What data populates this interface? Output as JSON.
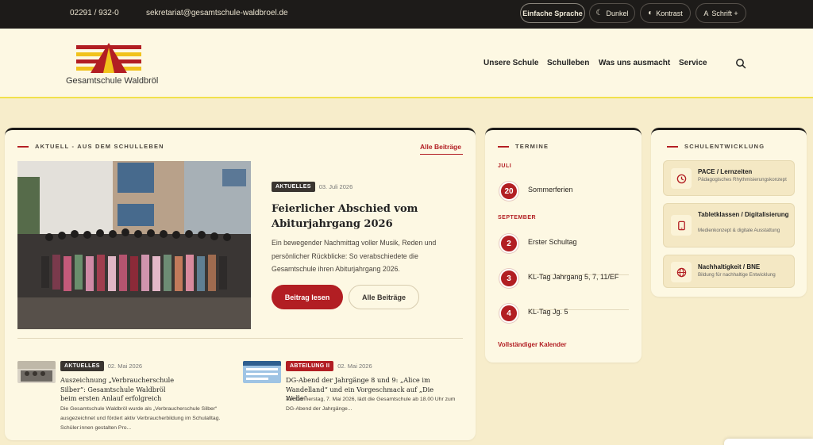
{
  "topbar": {
    "phone": "02291 / 932-0",
    "email": "sekretariat@gesamtschule-waldbroel.de",
    "buttons": {
      "simple_language": "Einfache Sprache",
      "dark": "Dunkel",
      "contrast": "Kontrast",
      "font": "Schrift +",
      "font_prefix": "A"
    }
  },
  "header": {
    "logo_text": "Gesamtschule Waldbröl",
    "nav": [
      "Unsere Schule",
      "Schulleben",
      "Was uns ausmacht",
      "Service"
    ]
  },
  "news": {
    "section_title": "AKTUELL - AUS DEM SCHULLEBEN",
    "all_link": "Alle Beiträge",
    "featured": {
      "badge": "AKTUELLES",
      "date": "03. Juli 2026",
      "title": "Feierlicher Abschied vom Abiturjahrgang 2026",
      "text": "Ein bewegender Nachmittag voller Musik, Reden und persönlicher Rückblicke: So verabschiedete die Gesamtschule ihren Abiturjahrgang 2026.",
      "read_button": "Beitrag lesen",
      "all_button": "Alle Beiträge"
    },
    "items": [
      {
        "badge": "AKTUELLES",
        "date": "02. Mai 2026",
        "title": "Auszeichnung „Verbraucherschule Silber“: Gesamtschule Waldbröl beim ersten Anlauf erfolgreich",
        "text": "Die Gesamtschule Waldbröl wurde als „Verbraucherschule Silber“ ausgezeichnet und fördert aktiv Verbraucherbildung im Schulalltag. Schüler:innen gestalten Pro..."
      },
      {
        "badge": "ABTEILUNG II",
        "date": "02. Mai 2026",
        "title": "DG-Abend der Jahrgänge 8 und 9: „Alice im Wandelland“ und ein Vorgeschmack auf „Die Welle“",
        "text": "Am Donnerstag, 7. Mai 2026, lädt die Gesamtschule ab 18.00 Uhr zum DG-Abend der Jahrgänge..."
      }
    ]
  },
  "termine": {
    "section_title": "TERMINE",
    "months": [
      "JULI",
      "SEPTEMBER"
    ],
    "events": [
      {
        "day": "20",
        "label": "Sommerferien"
      },
      {
        "day": "2",
        "label": "Erster Schultag"
      },
      {
        "day": "3",
        "label": "KL-Tag Jahrgang 5, 7, 11/EF"
      },
      {
        "day": "4",
        "label": "KL-Tag Jg. 5"
      }
    ],
    "calendar_link": "Vollständiger Kalender"
  },
  "schulentwicklung": {
    "section_title": "SCHULENTWICKLUNG",
    "cards": [
      {
        "icon": "clock-icon",
        "title": "PACE / Lernzeiten",
        "subtitle": "Pädagogisches Rhythmisierungskonzept"
      },
      {
        "icon": "tablet-icon",
        "title": "Tabletklassen / Digitalisierung",
        "subtitle": "Medienkonzept & digitale Ausstattung"
      },
      {
        "icon": "globe-icon",
        "title": "Nachhaltigkeit / BNE",
        "subtitle": "Bildung für nachhaltige Entwicklung"
      }
    ]
  },
  "colors": {
    "accent_red": "#b21e23",
    "dark": "#1d1b19",
    "cream": "#fdf8e3",
    "background": "#f7edcb",
    "header_line": "#f1e14b"
  }
}
